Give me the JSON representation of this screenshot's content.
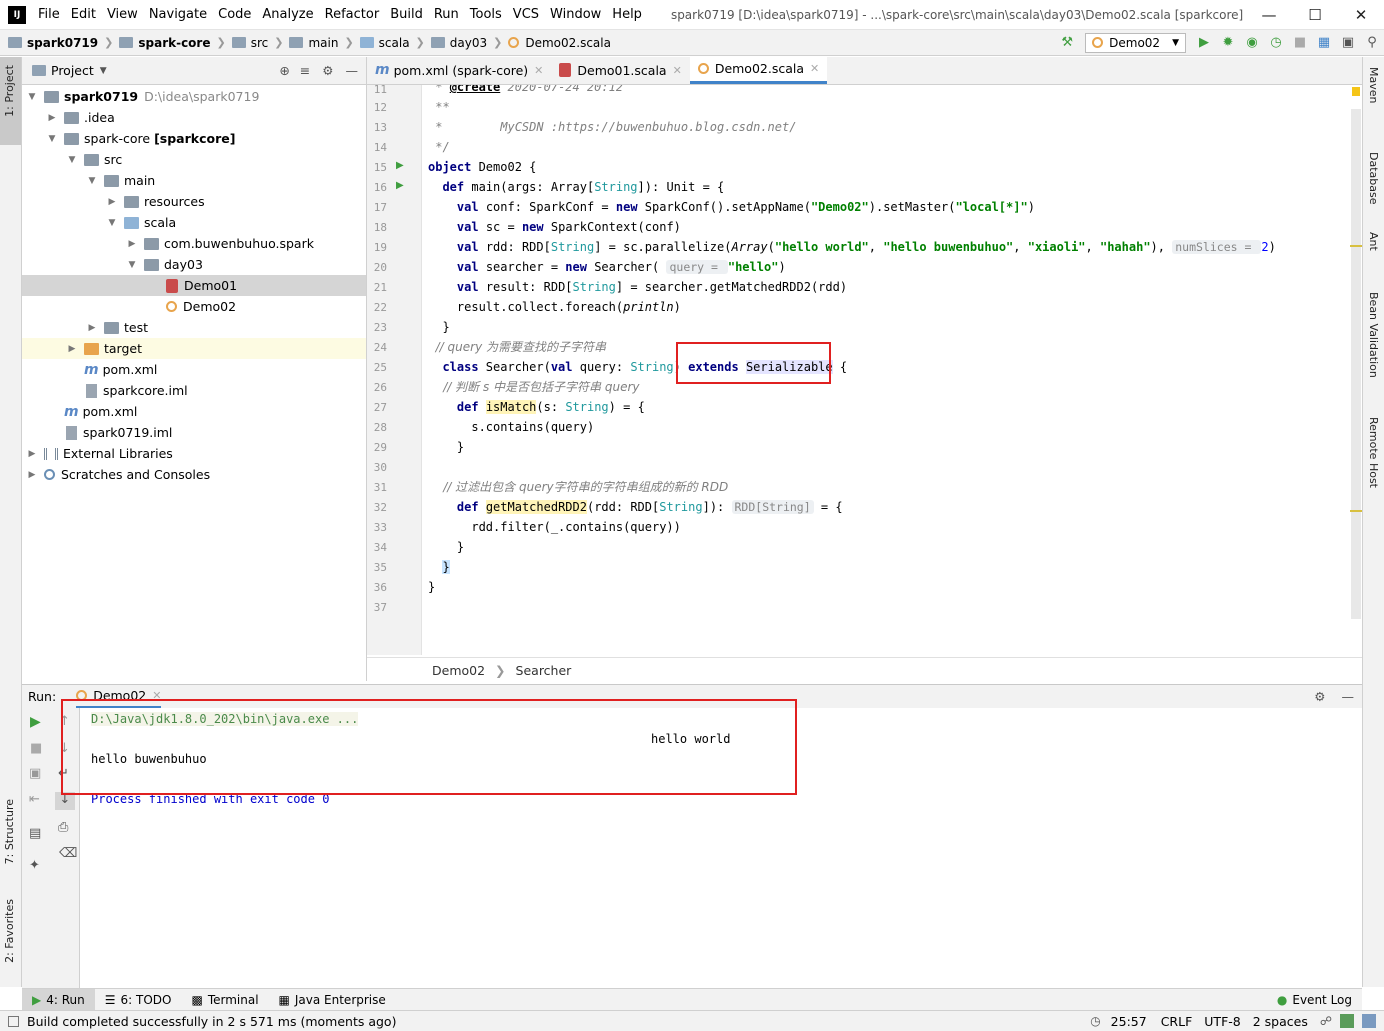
{
  "window": {
    "title": "spark0719 [D:\\idea\\spark0719] - ...\\spark-core\\src\\main\\scala\\day03\\Demo02.scala [sparkcore]",
    "menu": [
      "File",
      "Edit",
      "View",
      "Navigate",
      "Code",
      "Analyze",
      "Refactor",
      "Build",
      "Run",
      "Tools",
      "VCS",
      "Window",
      "Help"
    ]
  },
  "navbar": {
    "crumbs": [
      "spark0719",
      "spark-core",
      "src",
      "main",
      "scala",
      "day03",
      "Demo02.scala"
    ],
    "run_config": "Demo02"
  },
  "left_strip": {
    "project": "1: Project",
    "structure": "7: Structure",
    "favorites": "2: Favorites"
  },
  "right_strip": {
    "maven": "Maven",
    "database": "Database",
    "ant": "Ant",
    "bean": "Bean Validation",
    "remote": "Remote Host"
  },
  "project": {
    "header": "Project",
    "root": "spark0719",
    "root_path": "D:\\idea\\spark0719",
    "items": {
      "idea": ".idea",
      "sparkcore": "spark-core",
      "sparkcore_tag": "[sparkcore]",
      "src": "src",
      "main": "main",
      "resources": "resources",
      "scala": "scala",
      "pkg": "com.buwenbuhuo.spark",
      "day03": "day03",
      "demo01": "Demo01",
      "demo02": "Demo02",
      "test": "test",
      "target": "target",
      "pom_inner": "pom.xml",
      "iml_inner": "sparkcore.iml",
      "pom_root": "pom.xml",
      "iml_root": "spark0719.iml",
      "ext": "External Libraries",
      "scratch": "Scratches and Consoles"
    }
  },
  "tabs": [
    {
      "label": "pom.xml (spark-core)"
    },
    {
      "label": "Demo01.scala"
    },
    {
      "label": "Demo02.scala"
    }
  ],
  "code": {
    "line_numbers": [
      "11",
      "12",
      "13",
      "14",
      "15",
      "16",
      "17",
      "18",
      "19",
      "20",
      "21",
      "22",
      "23",
      "24",
      "25",
      "26",
      "27",
      "28",
      "29",
      "30",
      "31",
      "32",
      "33",
      "34",
      "35",
      "36",
      "37"
    ],
    "l11_a": " * ",
    "l11_b": "@create",
    "l11_c": " 2020-07-24 20:12",
    "l12": " **",
    "l13": " *        MyCSDN :https://buwenbuhuo.blog.csdn.net/",
    "l14": " */",
    "l15_kw": "object",
    "l15_rest": " Demo02 {",
    "l16_kw": "def",
    "l16_rest": " main(args: Array[",
    "l16_ty": "String",
    "l16_end": "]): Unit = {",
    "l17_kw": "val",
    "l17_a": " conf: SparkConf = ",
    "l17_new": "new",
    "l17_b": " SparkConf().setAppName(",
    "l17_s1": "\"Demo02\"",
    "l17_c": ").setMaster(",
    "l17_s2": "\"local[*]\"",
    "l17_d": ")",
    "l18_kw": "val",
    "l18_a": " sc = ",
    "l18_new": "new",
    "l18_b": " SparkContext(conf)",
    "l19_kw": "val",
    "l19_a": " rdd: RDD[",
    "l19_ty": "String",
    "l19_b": "] = sc.parallelize(",
    "l19_arr": "Array",
    "l19_c": "(",
    "l19_s1": "\"hello world\"",
    "l19_d": ", ",
    "l19_s2": "\"hello buwenbuhuo\"",
    "l19_e": ", ",
    "l19_s3": "\"xiaoli\"",
    "l19_f": ", ",
    "l19_s4": "\"hahah\"",
    "l19_g": "), ",
    "l19_hint": "numSlices = ",
    "l19_num": "2",
    "l19_h": ")",
    "l20_kw": "val",
    "l20_a": " searcher = ",
    "l20_new": "new",
    "l20_b": " Searcher( ",
    "l20_hint": "query = ",
    "l20_s": "\"hello\"",
    "l20_c": ")",
    "l21_kw": "val",
    "l21_a": " result: RDD[",
    "l21_ty": "String",
    "l21_b": "] = searcher.getMatchedRDD2(rdd)",
    "l22_a": "result.collect.foreach(",
    "l22_fn": "println",
    "l22_b": ")",
    "l23": "}",
    "l24": "// query 为需要查找的子字符串",
    "l25_kw": "class",
    "l25_a": " Searcher(",
    "l25_val": "val",
    "l25_b": " query: ",
    "l25_ty": "String",
    "l25_c": ") ",
    "l25_ext": "extends",
    "l25_d": " ",
    "l25_ser": "Serializable",
    "l25_e": " {",
    "l26": "// 判断 s 中是否包括子字符串 query",
    "l27_kw": "def",
    "l27_a": " ",
    "l27_fn": "isMatch",
    "l27_b": "(s: ",
    "l27_ty": "String",
    "l27_c": ") = {",
    "l28": "s.contains(query)",
    "l29": "}",
    "l31": "// 过滤出包含 query字符串的字符串组成的新的 RDD",
    "l32_kw": "def",
    "l32_a": " ",
    "l32_fn": "getMatchedRDD2",
    "l32_b": "(rdd: RDD[",
    "l32_ty": "String",
    "l32_c": "]): ",
    "l32_hint": "RDD[String]",
    "l32_d": " = {",
    "l33": "rdd.filter(_.contains(query))",
    "l34": "}",
    "l35": "}",
    "l36": "}"
  },
  "breadcrumb": {
    "a": "Demo02",
    "b": "Searcher"
  },
  "run": {
    "label": "Run:",
    "tab": "Demo02",
    "cmd": "D:\\Java\\jdk1.8.0_202\\bin\\java.exe ...",
    "out1": "hello world",
    "out2": "hello buwenbuhuo",
    "finish": "Process finished with exit code 0"
  },
  "tooltabs": {
    "run": "4: Run",
    "todo": "6: TODO",
    "terminal": "Terminal",
    "javaee": "Java Enterprise",
    "eventlog": "Event Log"
  },
  "status": {
    "message": "Build completed successfully in 2 s 571 ms (moments ago)",
    "pos": "25:57",
    "crlf": "CRLF",
    "enc": "UTF-8",
    "indent": "2 spaces"
  },
  "colors": {
    "accent": "#4083c9",
    "highlight_box": "#e02020",
    "run_green": "#3f9e3f"
  }
}
